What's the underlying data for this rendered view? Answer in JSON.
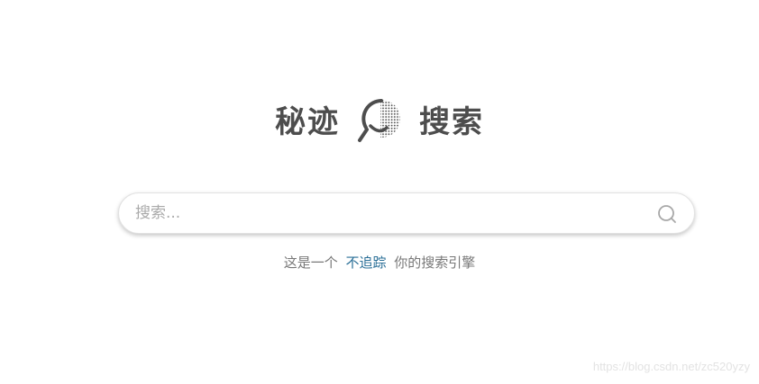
{
  "logo": {
    "left_text": "秘迹",
    "right_text": "搜索"
  },
  "search": {
    "placeholder": "搜索...",
    "value": ""
  },
  "tagline": {
    "prefix": "这是一个",
    "highlight": "不追踪",
    "suffix": "你的搜索引擎"
  },
  "watermark": "https://blog.csdn.net/zc520yzy",
  "colors": {
    "logo_text": "#4d4d4d",
    "tagline_text": "#777777",
    "highlight": "#2a6f97",
    "placeholder": "#aaaaaa",
    "watermark": "#e3e3e3"
  },
  "icons": {
    "logo": "magnifier-smile-dots-icon",
    "search": "search-icon"
  }
}
